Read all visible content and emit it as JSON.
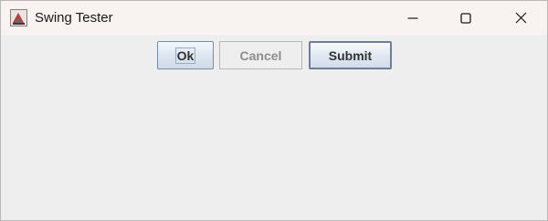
{
  "window": {
    "title": "Swing Tester",
    "controls": {
      "minimize_icon": "minimize-icon",
      "maximize_icon": "maximize-icon",
      "close_icon": "close-icon"
    }
  },
  "buttons": {
    "ok_label": "Ok",
    "cancel_label": "Cancel",
    "submit_label": "Submit"
  },
  "colors": {
    "content_background": "#eeeeee",
    "titlebar_background": "#f8f2f1",
    "button_text": "#333333",
    "disabled_text": "#8d8d8d"
  }
}
